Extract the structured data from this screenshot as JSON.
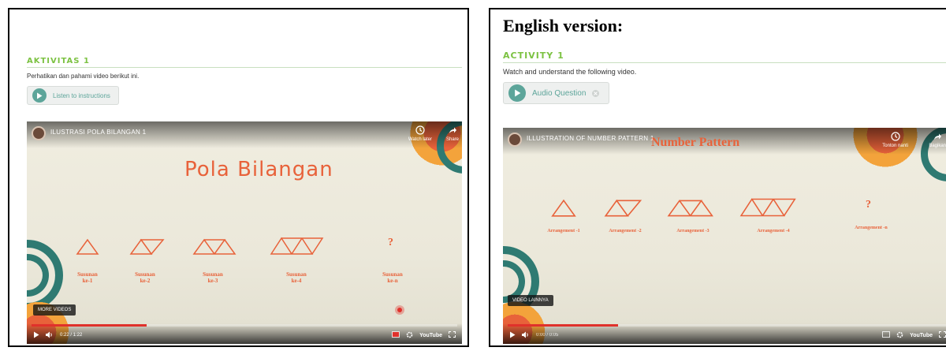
{
  "left": {
    "activity_title": "AKTIVITAS 1",
    "instruction": "Perhatikan dan pahami video berikut ini.",
    "audio_label": "Listen to instructions",
    "video": {
      "title": "ILUSTRASI POLA BILANGAN 1",
      "slide_title": "Pola Bilangan",
      "watch_later": "Watch later",
      "share": "Share",
      "arrangements": [
        "Susunan\nke-1",
        "Susunan\nke-2",
        "Susunan\nke-3",
        "Susunan\nke-4",
        "Susunan\nke-n"
      ],
      "question_mark": "?",
      "more_videos": "MORE VIDEOS",
      "time": "0:22 / 1:22",
      "youtube": "YouTube",
      "progress": 0.27
    }
  },
  "right": {
    "heading": "English version:",
    "activity_title": "ACTIVITY 1",
    "instruction": "Watch and understand the following video.",
    "audio_label": "Audio Question",
    "video": {
      "title": "ILLUSTRATION OF NUMBER PATTERN 1",
      "slide_title": "Number Pattern",
      "watch_later": "Tonton nanti",
      "share": "Bagikan",
      "arrangements": [
        "Arrangement -1",
        "Arrangement -2",
        "Arrangement -3",
        "Arrangement -4",
        "Arrangement -n"
      ],
      "question_mark": "?",
      "more_videos": "VIDEO LAINNYA",
      "time": "0:00 / 0:05",
      "youtube": "YouTube",
      "progress": 0.25
    }
  },
  "colors": {
    "activity_green": "#7cc242",
    "teal": "#5da59a",
    "slide_orange": "#e8623a",
    "youtube_red": "#e0312b"
  }
}
